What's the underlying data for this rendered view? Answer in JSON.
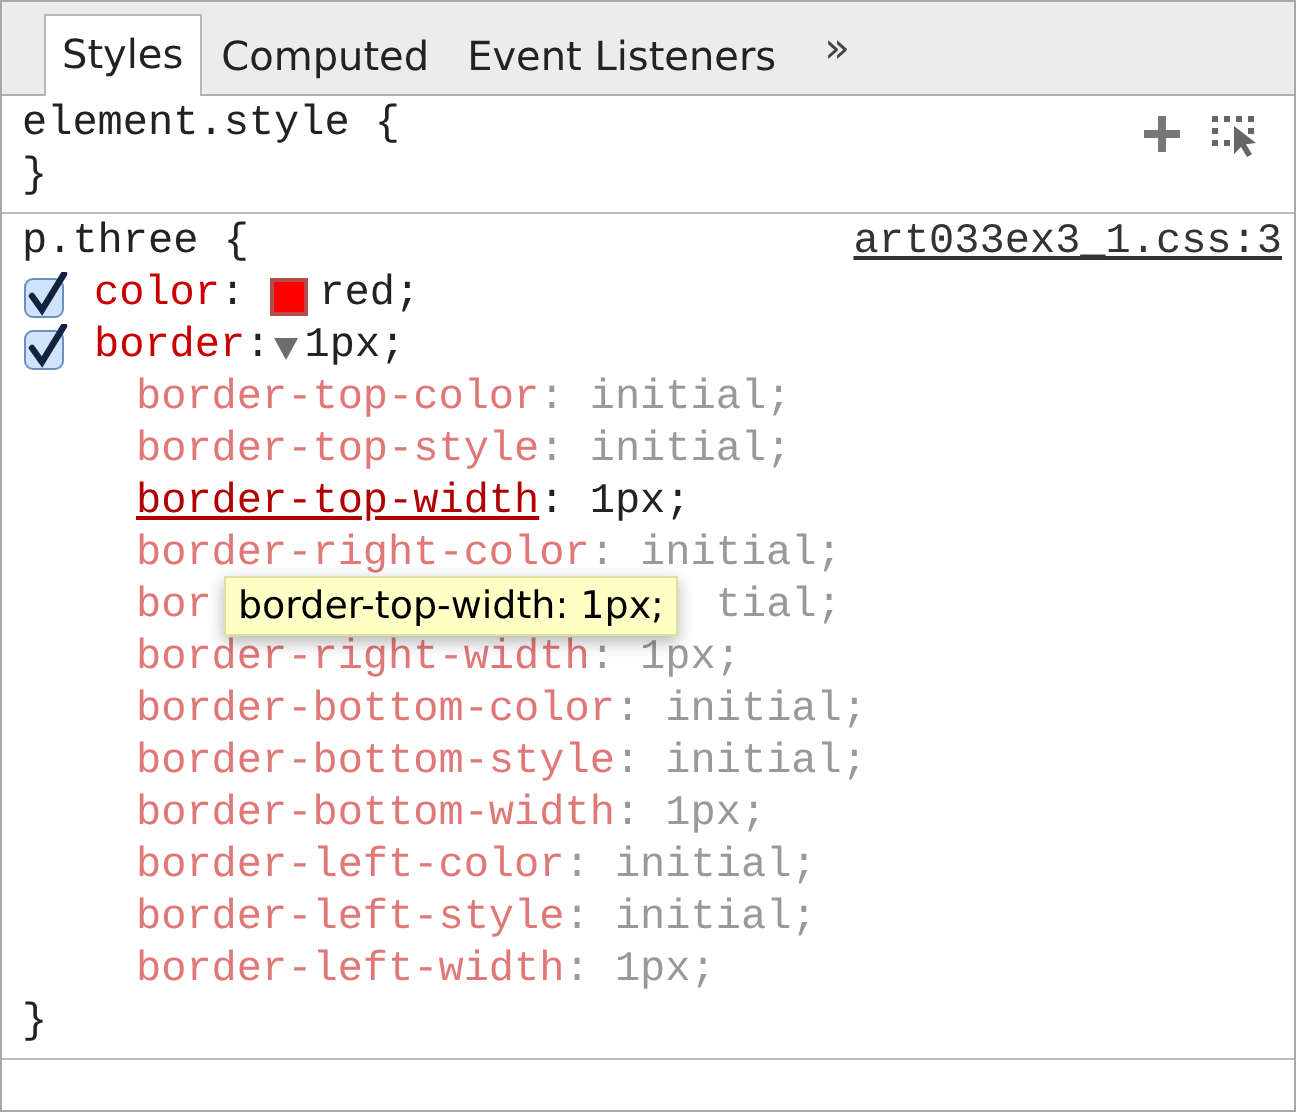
{
  "tabs": [
    {
      "label": "Styles",
      "selected": true
    },
    {
      "label": "Computed",
      "selected": false
    },
    {
      "label": "Event Listeners",
      "selected": false
    }
  ],
  "tabs_overflow": "»",
  "rules": [
    {
      "selector": "element.style {",
      "closing": "}",
      "toolbar": true
    },
    {
      "selector": "p.three {",
      "source": "art033ex3_1.css:3",
      "closing": "}",
      "properties": [
        {
          "name": "color",
          "separator": ":",
          "value": "red;",
          "checked": true,
          "color": "#ff0000"
        },
        {
          "name": "border",
          "separator": ":",
          "value": "1px;",
          "checked": true,
          "expanded": true,
          "children": [
            {
              "name": "border-top-color",
              "value": ": initial;",
              "hovered": false
            },
            {
              "name": "border-top-style",
              "value": ": initial;",
              "hovered": false
            },
            {
              "name": "border-top-width",
              "value": ": 1px;",
              "hovered": true
            },
            {
              "name": "border-right-color",
              "value": ": initial;",
              "hovered": false
            },
            {
              "name": "bor",
              "value": "tial;",
              "hovered": false,
              "covered": true
            },
            {
              "name": "border-right-width",
              "value": ": 1px;",
              "hovered": false
            },
            {
              "name": "border-bottom-color",
              "value": ": initial;",
              "hovered": false
            },
            {
              "name": "border-bottom-style",
              "value": ": initial;",
              "hovered": false
            },
            {
              "name": "border-bottom-width",
              "value": ": 1px;",
              "hovered": false
            },
            {
              "name": "border-left-color",
              "value": ": initial;",
              "hovered": false
            },
            {
              "name": "border-left-style",
              "value": ": initial;",
              "hovered": false
            },
            {
              "name": "border-left-width",
              "value": ": 1px;",
              "hovered": false
            }
          ]
        }
      ]
    }
  ],
  "tooltip": {
    "text": "border-top-width: 1px;"
  }
}
